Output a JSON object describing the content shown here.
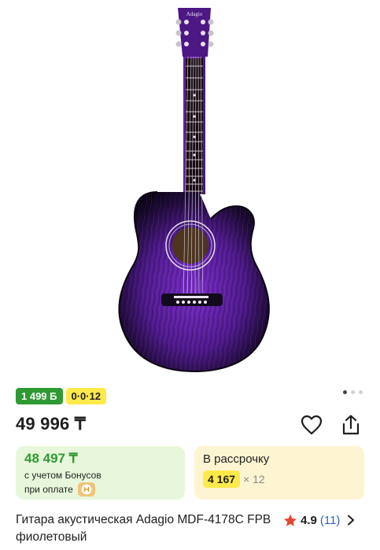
{
  "product": {
    "image_alt": "Гитара акустическая Adagio MDF-4178C FPB фиолетовый",
    "brand_on_headstock": "Adagio",
    "gallery_dots": 3,
    "gallery_active": 0,
    "badges": {
      "bonus": "1 499 Б",
      "installment": "0·0·12"
    },
    "price": "49 996 ₸",
    "bonus_price": {
      "amount": "48 497 ₸",
      "note_line1": "с учетом Бонусов",
      "note_line2": "при оплате"
    },
    "installment": {
      "title": "В рассрочку",
      "monthly": "4 167",
      "months": "× 12"
    },
    "title": "Гитара акустическая Adagio MDF-4178C FPB фиолетовый",
    "rating": {
      "value": "4.9",
      "count": "(11)"
    }
  },
  "colors": {
    "bonus_green": "#2e9a32",
    "installment_yellow": "#ffe94a",
    "green_card": "#e8f7db",
    "yellow_card": "#fdf4d2",
    "star": "#e8452c",
    "link_blue": "#2b62c9"
  },
  "icons": [
    "heart-icon",
    "share-icon",
    "star-icon",
    "chevron-right-icon",
    "halyk-logo-icon"
  ]
}
